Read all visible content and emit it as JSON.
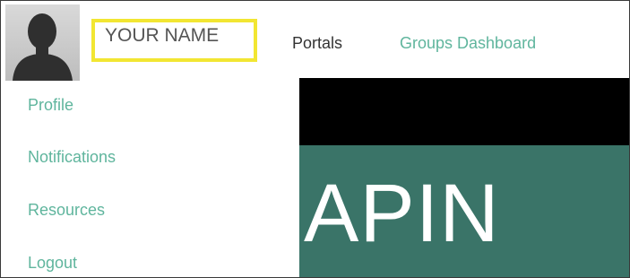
{
  "user": {
    "name": "YOUR NAME",
    "avatar_icon": "user-silhouette-icon"
  },
  "nav": {
    "portals": "Portals",
    "groups_dashboard": "Groups Dashboard"
  },
  "menu": {
    "items": [
      {
        "label": "Profile"
      },
      {
        "label": "Notifications"
      },
      {
        "label": "Resources"
      },
      {
        "label": "Logout"
      }
    ]
  },
  "banner": {
    "text": "APIN"
  },
  "colors": {
    "link": "#5fb59d",
    "highlight": "#f2e632",
    "banner_bg": "#3a7468",
    "banner_top": "#000000"
  }
}
